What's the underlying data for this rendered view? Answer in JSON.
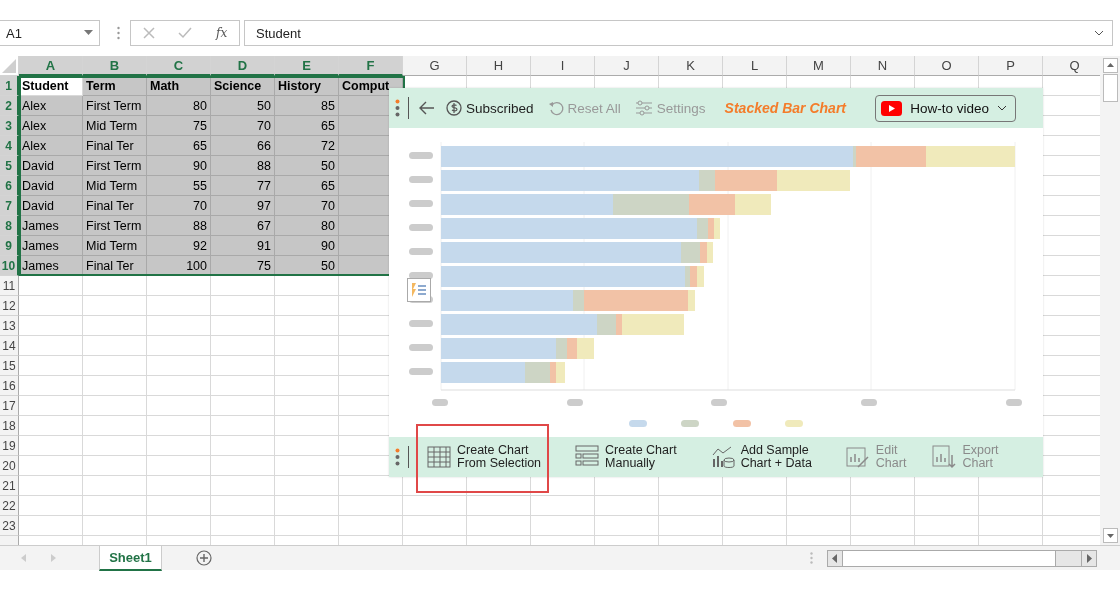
{
  "formula_bar": {
    "name_box": "A1",
    "function_label": "fx",
    "value": "Student"
  },
  "columns": [
    {
      "header": "A",
      "selected": true,
      "active": true,
      "kind": "text"
    },
    {
      "header": "B",
      "selected": true,
      "active": false,
      "kind": "text"
    },
    {
      "header": "C",
      "selected": true,
      "active": false,
      "kind": "number"
    },
    {
      "header": "D",
      "selected": true,
      "active": false,
      "kind": "number"
    },
    {
      "header": "E",
      "selected": true,
      "active": false,
      "kind": "number"
    },
    {
      "header": "F",
      "selected": true,
      "active": false,
      "kind": "text"
    },
    {
      "header": "G",
      "selected": false,
      "active": false
    },
    {
      "header": "H",
      "selected": false,
      "active": false
    },
    {
      "header": "I",
      "selected": false,
      "active": false
    },
    {
      "header": "J",
      "selected": false,
      "active": false
    },
    {
      "header": "K",
      "selected": false,
      "active": false
    },
    {
      "header": "L",
      "selected": false,
      "active": false
    },
    {
      "header": "M",
      "selected": false,
      "active": false
    },
    {
      "header": "N",
      "selected": false,
      "active": false
    },
    {
      "header": "O",
      "selected": false,
      "active": false
    },
    {
      "header": "P",
      "selected": false,
      "active": false
    },
    {
      "header": "Q",
      "selected": false,
      "active": false
    }
  ],
  "rows": [
    {
      "header": "1",
      "selected": true,
      "active": true,
      "kind": "header",
      "cells": [
        "Student",
        "Term",
        "Math",
        "Science",
        "History",
        "Comput"
      ]
    },
    {
      "header": "2",
      "selected": true,
      "active": false,
      "kind": "data",
      "cells": [
        "Alex",
        "First Term",
        "80",
        "50",
        "85"
      ]
    },
    {
      "header": "3",
      "selected": true,
      "active": false,
      "kind": "data",
      "cells": [
        "Alex",
        "Mid Term",
        "75",
        "70",
        "65"
      ]
    },
    {
      "header": "4",
      "selected": true,
      "active": false,
      "kind": "data",
      "cells": [
        "Alex",
        "Final Ter",
        "65",
        "66",
        "72"
      ]
    },
    {
      "header": "5",
      "selected": true,
      "active": false,
      "kind": "data",
      "cells": [
        "David",
        "First Term",
        "90",
        "88",
        "50"
      ]
    },
    {
      "header": "6",
      "selected": true,
      "active": false,
      "kind": "data",
      "cells": [
        "David",
        "Mid Term",
        "55",
        "77",
        "65"
      ]
    },
    {
      "header": "7",
      "selected": true,
      "active": false,
      "kind": "data",
      "cells": [
        "David",
        "Final Ter",
        "70",
        "97",
        "70"
      ]
    },
    {
      "header": "8",
      "selected": true,
      "active": false,
      "kind": "data",
      "cells": [
        "James",
        "First Term",
        "88",
        "67",
        "80"
      ]
    },
    {
      "header": "9",
      "selected": true,
      "active": false,
      "kind": "data",
      "cells": [
        "James",
        "Mid Term",
        "92",
        "91",
        "90"
      ]
    },
    {
      "header": "10",
      "selected": true,
      "active": false,
      "kind": "data",
      "cells": [
        "James",
        "Final Ter",
        "100",
        "75",
        "50"
      ]
    },
    {
      "header": "11",
      "selected": false,
      "active": false,
      "cells": []
    },
    {
      "header": "12",
      "selected": false,
      "active": false,
      "cells": []
    },
    {
      "header": "13",
      "selected": false,
      "active": false,
      "cells": []
    },
    {
      "header": "14",
      "selected": false,
      "active": false,
      "cells": []
    },
    {
      "header": "15",
      "selected": false,
      "active": false,
      "cells": []
    },
    {
      "header": "16",
      "selected": false,
      "active": false,
      "cells": []
    },
    {
      "header": "17",
      "selected": false,
      "active": false,
      "cells": []
    },
    {
      "header": "18",
      "selected": false,
      "active": false,
      "cells": []
    },
    {
      "header": "19",
      "selected": false,
      "active": false,
      "cells": []
    },
    {
      "header": "20",
      "selected": false,
      "active": false,
      "cells": []
    },
    {
      "header": "21",
      "selected": false,
      "active": false,
      "cells": []
    },
    {
      "header": "22",
      "selected": false,
      "active": false,
      "cells": []
    },
    {
      "header": "23",
      "selected": false,
      "active": false,
      "cells": []
    }
  ],
  "chart_panel": {
    "top_bar": {
      "subscription": "Subscribed",
      "reset": {
        "label": "Reset All",
        "disabled": true
      },
      "settings": {
        "label": "Settings",
        "disabled": true
      },
      "title": "Stacked Bar Chart",
      "video_button": "How-to video"
    },
    "bottom_bar": [
      {
        "kind": "table",
        "lines": [
          "Create Chart",
          "From Selection"
        ],
        "disabled": false,
        "highlighted": true
      },
      {
        "kind": "form",
        "lines": [
          "Create Chart",
          "Manually"
        ],
        "disabled": false,
        "highlighted": false
      },
      {
        "kind": "sample",
        "lines": [
          "Add Sample",
          "Chart + Data"
        ],
        "disabled": false,
        "highlighted": false
      },
      {
        "kind": "edit",
        "lines": [
          "Edit",
          "Chart"
        ],
        "disabled": true,
        "highlighted": false
      },
      {
        "kind": "export",
        "lines": [
          "Export",
          "Chart"
        ],
        "disabled": true,
        "highlighted": false
      }
    ]
  },
  "sheet_tabs": [
    {
      "label": "Sheet1",
      "selected": true
    }
  ]
}
